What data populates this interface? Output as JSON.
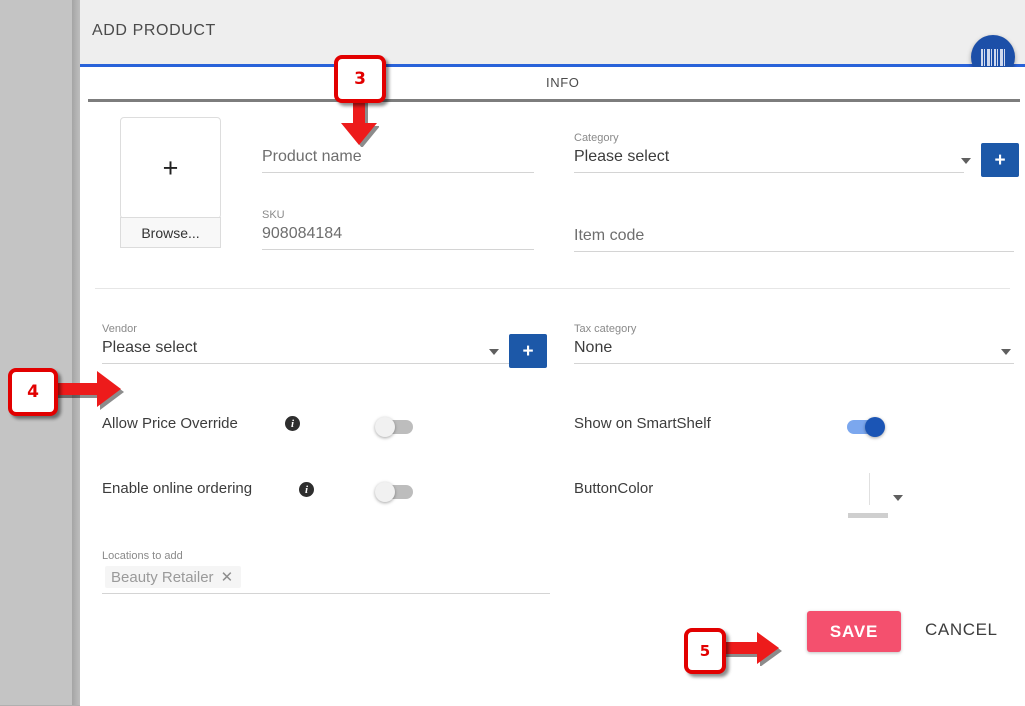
{
  "window": {
    "title": "ADD PRODUCT",
    "accent_color": "#2962d9",
    "header_bg": "#eeeeee"
  },
  "fab": {
    "icon": "barcode-icon",
    "color": "#1c4fa8"
  },
  "tabs": [
    {
      "label": "INFO",
      "active": true
    }
  ],
  "image_upload": {
    "placeholder_icon": "plus-icon",
    "plus": "+",
    "browse_label": "Browse..."
  },
  "fields": {
    "product_name": {
      "label": "",
      "placeholder": "Product name",
      "value": ""
    },
    "sku": {
      "label": "SKU",
      "value": "908084184"
    },
    "category": {
      "label": "Category",
      "value": "Please select",
      "add_button": "+"
    },
    "item_code": {
      "label": "",
      "placeholder": "Item code",
      "value": ""
    },
    "vendor": {
      "label": "Vendor",
      "value": "Please select",
      "add_button": "+"
    },
    "tax_category": {
      "label": "Tax category",
      "value": "None"
    },
    "locations": {
      "label": "Locations to add",
      "chip": "Beauty Retailer",
      "remove": "✕"
    },
    "button_color": {
      "label": "ButtonColor",
      "value": ""
    }
  },
  "toggles": [
    {
      "label": "Allow Price Override",
      "state": "off",
      "has_info": true
    },
    {
      "label": "Enable online ordering",
      "state": "off",
      "has_info": true
    },
    {
      "label": "Show on SmartShelf",
      "state": "on",
      "has_info": false
    }
  ],
  "actions": {
    "save_label": "SAVE",
    "save_color": "#f4506e",
    "cancel_label": "CANCEL"
  },
  "annotations": [
    {
      "number": "3",
      "direction": "down"
    },
    {
      "number": "4",
      "direction": "right"
    },
    {
      "number": "5",
      "direction": "right"
    }
  ],
  "info_icon_glyph": "i"
}
